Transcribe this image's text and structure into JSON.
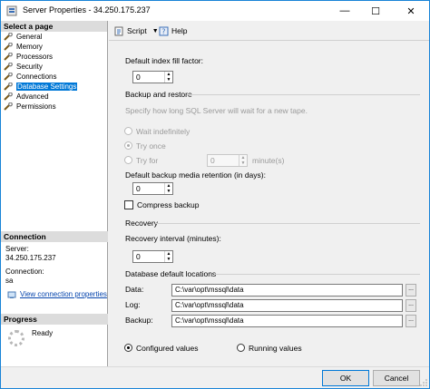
{
  "window": {
    "title": "Server Properties - 34.250.175.237"
  },
  "left": {
    "select_page_header": "Select a page",
    "pages": [
      {
        "label": "General"
      },
      {
        "label": "Memory"
      },
      {
        "label": "Processors"
      },
      {
        "label": "Security"
      },
      {
        "label": "Connections"
      },
      {
        "label": "Database Settings",
        "selected": true
      },
      {
        "label": "Advanced"
      },
      {
        "label": "Permissions"
      }
    ],
    "connection_header": "Connection",
    "server_label": "Server:",
    "server_value": "34.250.175.237",
    "connection_label": "Connection:",
    "connection_value": "sa",
    "view_connection_link": "View connection properties",
    "progress_header": "Progress",
    "progress_status": "Ready"
  },
  "toolbar": {
    "script_label": "Script",
    "help_label": "Help"
  },
  "form": {
    "fill_factor_label": "Default index fill factor:",
    "fill_factor_value": "0",
    "backup_restore_section": "Backup and restore",
    "backup_hint": "Specify how long SQL Server will wait for a new tape.",
    "wait_indefinitely": "Wait indefinitely",
    "try_once": "Try once",
    "try_for": "Try for",
    "try_for_value": "0",
    "minutes_unit": "minute(s)",
    "retention_label": "Default backup media retention (in days):",
    "retention_value": "0",
    "compress_backup": "Compress backup",
    "recovery_section": "Recovery",
    "recovery_interval_label": "Recovery interval (minutes):",
    "recovery_interval_value": "0",
    "locations_section": "Database default locations",
    "data_label": "Data:",
    "data_value": "C:\\var\\opt\\mssql\\data",
    "log_label": "Log:",
    "log_value": "C:\\var\\opt\\mssql\\data",
    "backup_label": "Backup:",
    "backup_value": "C:\\var\\opt\\mssql\\data",
    "browse_label": "...",
    "configured_values": "Configured values",
    "running_values": "Running values"
  },
  "buttons": {
    "ok": "OK",
    "cancel": "Cancel"
  },
  "window_controls": {
    "minimize": "—",
    "maximize": "☐",
    "close": "✕"
  },
  "colors": {
    "accent": "#0078d7",
    "border": "#1883d7"
  },
  "icons": [
    "app-icon",
    "wrench-icon",
    "script-icon",
    "help-icon",
    "connection-icon",
    "spinner-icon"
  ]
}
